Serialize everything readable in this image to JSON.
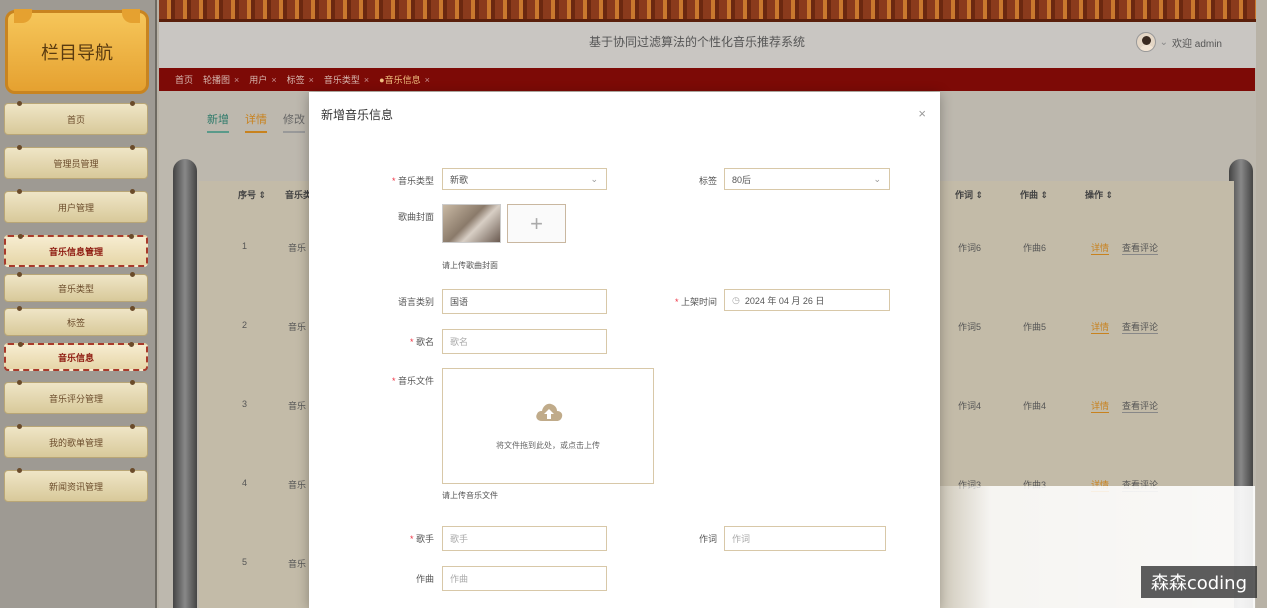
{
  "sidebar": {
    "title": "栏目导航",
    "items": [
      {
        "label": "首页",
        "active": false
      },
      {
        "label": "管理员管理",
        "active": false
      },
      {
        "label": "用户管理",
        "active": false
      },
      {
        "label": "音乐信息管理",
        "active": true
      },
      {
        "label": "音乐类型",
        "active": false
      },
      {
        "label": "标签",
        "active": false
      },
      {
        "label": "音乐信息",
        "active": true
      },
      {
        "label": "音乐评分管理",
        "active": false
      },
      {
        "label": "我的歌单管理",
        "active": false
      },
      {
        "label": "新闻资讯管理",
        "active": false
      }
    ]
  },
  "header": {
    "app_title": "基于协同过滤算法的个性化音乐推荐系统",
    "welcome": "欢迎 admin",
    "caret": "⌄"
  },
  "tabs": [
    {
      "label": "首页",
      "closable": false
    },
    {
      "label": "轮播图",
      "closable": true
    },
    {
      "label": "用户",
      "closable": true
    },
    {
      "label": "标签",
      "closable": true
    },
    {
      "label": "音乐类型",
      "closable": true
    },
    {
      "label": "●音乐信息",
      "closable": true,
      "active": true
    }
  ],
  "tab_close": "×",
  "main": {
    "actions": {
      "add": "新增",
      "detail": "详情",
      "edit": "修改"
    },
    "table": {
      "headers": {
        "select": "",
        "index": "序号 ⇕",
        "type": "音乐类",
        "lyricist": "作词 ⇕",
        "composer": "作曲 ⇕",
        "ops": "操作 ⇕"
      },
      "rows": [
        {
          "index": "1",
          "type": "音乐",
          "lyricist": "作词6",
          "composer": "作曲6"
        },
        {
          "index": "2",
          "type": "音乐",
          "lyricist": "作词5",
          "composer": "作曲5"
        },
        {
          "index": "3",
          "type": "音乐",
          "lyricist": "作词4",
          "composer": "作曲4"
        },
        {
          "index": "4",
          "type": "音乐",
          "lyricist": "作词3",
          "composer": "作曲3"
        },
        {
          "index": "5",
          "type": "音乐",
          "lyricist": "",
          "composer": ""
        }
      ],
      "op_detail": "详情",
      "op_comment": "查看评论"
    }
  },
  "dialog": {
    "title": "新增音乐信息",
    "close": "×",
    "music_type": {
      "label": "音乐类型",
      "value": "新歌"
    },
    "tag": {
      "label": "标签",
      "value": "80后"
    },
    "cover": {
      "label": "歌曲封面",
      "hint": "请上传歌曲封面",
      "add": "+"
    },
    "language": {
      "label": "语言类别",
      "value": "国语"
    },
    "release": {
      "label": "上架时间",
      "value": "2024 年 04 月 26 日",
      "icon": "◷"
    },
    "song_name": {
      "label": "歌名",
      "placeholder": "歌名"
    },
    "music_file": {
      "label": "音乐文件",
      "drop_text": "将文件拖到此处，或点击上传",
      "hint": "请上传音乐文件"
    },
    "singer": {
      "label": "歌手",
      "placeholder": "歌手"
    },
    "lyricist": {
      "label": "作词",
      "placeholder": "作词"
    },
    "composer": {
      "label": "作曲",
      "placeholder": "作曲"
    },
    "chevron": "⌄"
  },
  "watermark": "森森coding",
  "colors": {
    "accent_red": "#7d0a06",
    "required": "#e34444",
    "field_border": "#d8c8a8",
    "link_orange": "#c8821e"
  }
}
